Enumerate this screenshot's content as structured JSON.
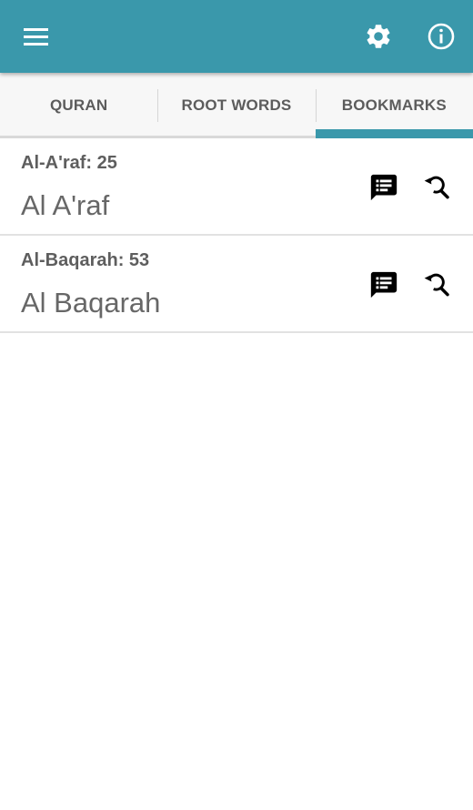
{
  "appbar": {
    "menu_icon": "hamburger-menu-icon",
    "settings_icon": "gear-icon",
    "info_icon": "info-icon",
    "color": "#3a98ab"
  },
  "tabs": [
    {
      "label": "QURAN",
      "active": false
    },
    {
      "label": "ROOT WORDS",
      "active": false
    },
    {
      "label": "BOOKMARKS",
      "active": true
    }
  ],
  "bookmarks": [
    {
      "title": "Al-A'raf: 25",
      "name": "Al A'raf",
      "notes_icon": "comment-text-icon",
      "search_icon": "search-history-icon"
    },
    {
      "title": "Al-Baqarah: 53",
      "name": "Al Baqarah",
      "notes_icon": "comment-text-icon",
      "search_icon": "search-history-icon"
    }
  ]
}
